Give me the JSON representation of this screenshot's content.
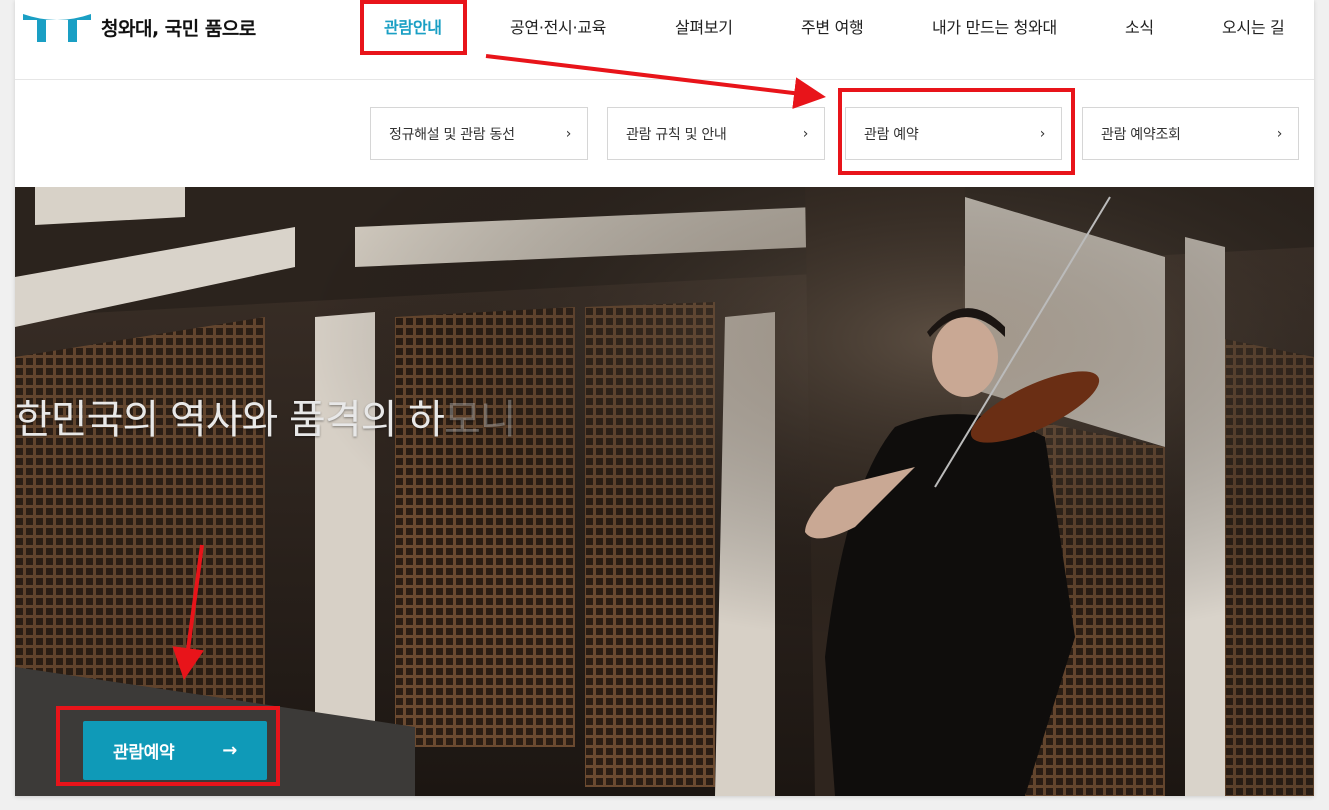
{
  "header": {
    "logo_text": "청와대, 국민 품으로",
    "nav": [
      {
        "label": "관람안내",
        "active": true
      },
      {
        "label": "공연·전시·교육"
      },
      {
        "label": "살펴보기"
      },
      {
        "label": "주변 여행"
      },
      {
        "label": "내가 만드는 청와대"
      },
      {
        "label": "소식"
      },
      {
        "label": "오시는 길"
      }
    ]
  },
  "submenu": {
    "items": [
      {
        "label": "정규해설 및 관람 동선",
        "chevron": "›"
      },
      {
        "label": "관람 규칙 및 안내",
        "chevron": "›"
      },
      {
        "label": "관람 예약",
        "chevron": "›"
      },
      {
        "label": "관람 예약조회",
        "chevron": "›"
      }
    ]
  },
  "hero": {
    "title_main": "한민국의 역사와 품격의 하",
    "title_fade": "모니",
    "cta_label": "관람예약",
    "cta_arrow": "→"
  },
  "colors": {
    "accent": "#1a9fc4",
    "cta": "#0f9ab8",
    "annotation": "#e8141a"
  },
  "icons": [
    "logo-roof-icon",
    "chevron-right-icon",
    "arrow-right-icon"
  ]
}
